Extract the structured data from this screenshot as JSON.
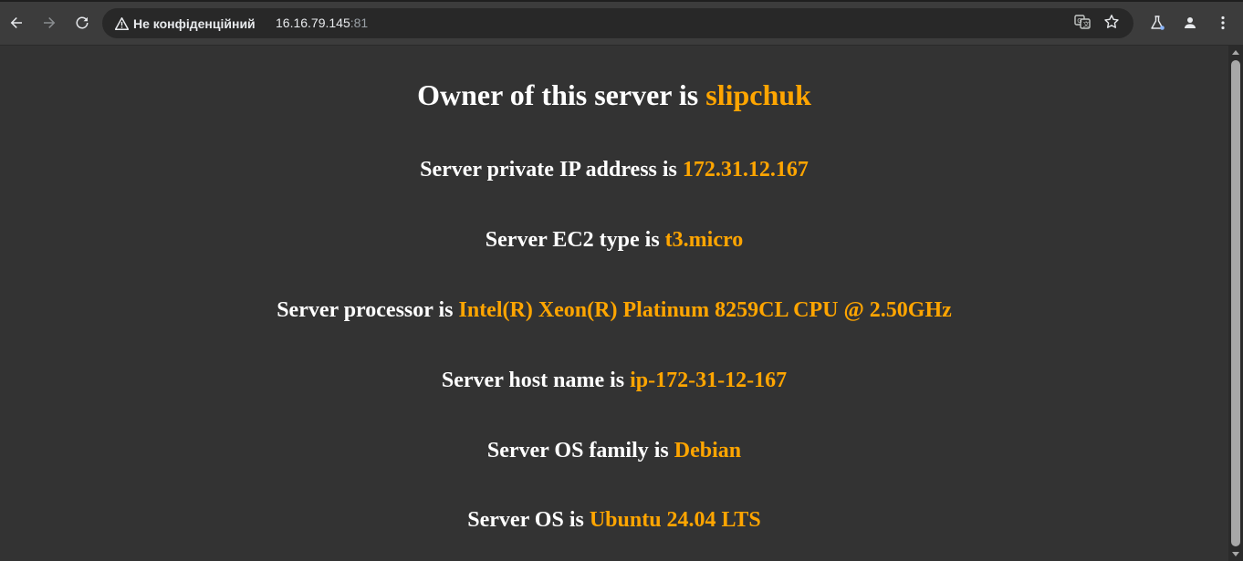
{
  "browser": {
    "security_label": "Не конфіденційний",
    "url_host": "16.16.79.145",
    "url_port": ":81",
    "icons": {
      "back": "back-arrow-icon",
      "forward": "forward-arrow-icon",
      "reload": "reload-icon",
      "warning": "warning-triangle-icon",
      "translate": "translate-icon",
      "bookmark": "star-icon",
      "labs": "flask-icon",
      "profile": "profile-icon",
      "menu": "kebab-menu-icon"
    }
  },
  "page": {
    "owner": {
      "label": "Owner of this server is ",
      "value": "slipchuk"
    },
    "private_ip": {
      "label": "Server private IP address is ",
      "value": "172.31.12.167"
    },
    "ec2_type": {
      "label": "Server EC2 type is ",
      "value": "t3.micro"
    },
    "processor": {
      "label": "Server processor is ",
      "value": "Intel(R) Xeon(R) Platinum 8259CL CPU @ 2.50GHz"
    },
    "host_name": {
      "label": "Server host name is ",
      "value": "ip-172-31-12-167"
    },
    "os_family": {
      "label": "Server OS family is ",
      "value": "Debian"
    },
    "os": {
      "label": "Server OS is ",
      "value": "Ubuntu 24.04 LTS"
    }
  },
  "colors": {
    "background": "#333333",
    "label": "#ffffff",
    "accent": "#ffa500"
  }
}
